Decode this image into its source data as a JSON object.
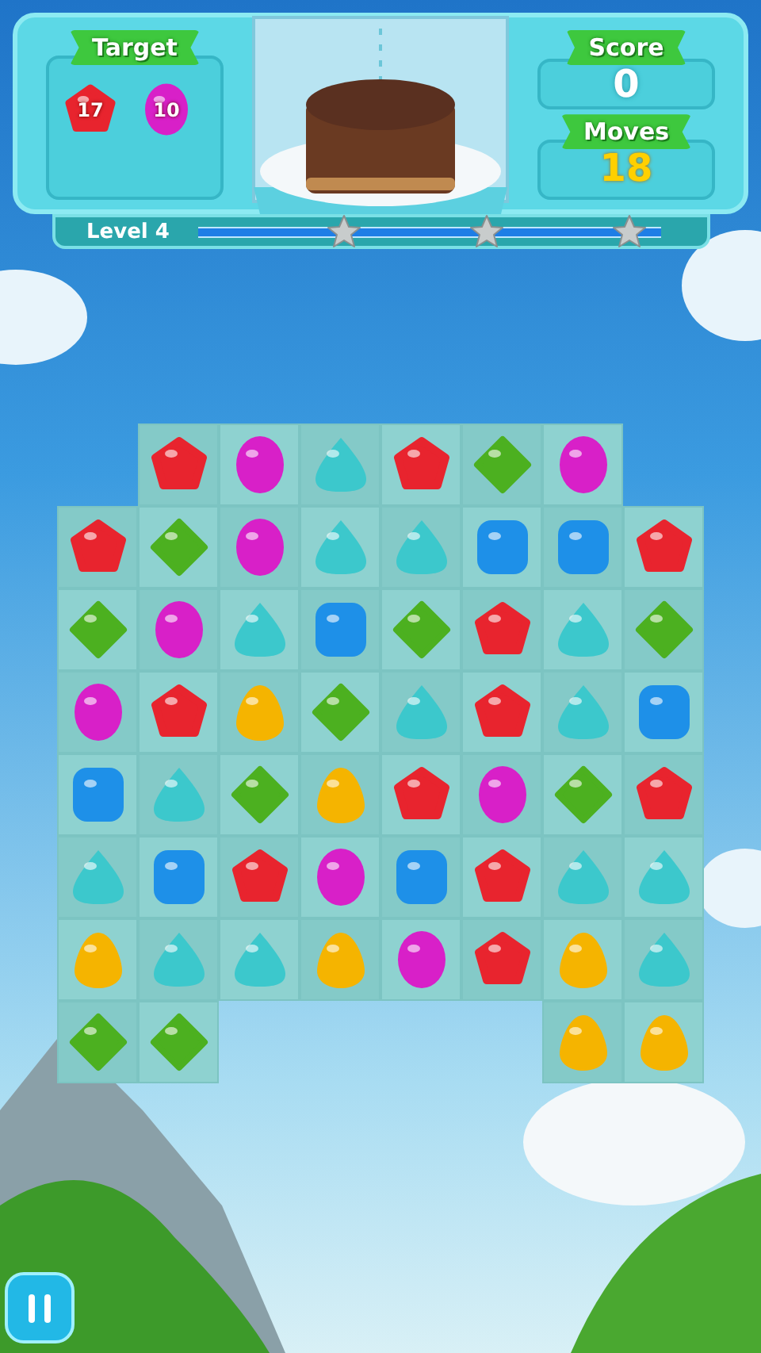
{
  "hud": {
    "target": {
      "label": "Target",
      "items": [
        {
          "kind": "pentagon",
          "count": "17"
        },
        {
          "kind": "oval",
          "count": "10"
        }
      ]
    },
    "score": {
      "label": "Score",
      "value": "0"
    },
    "moves": {
      "label": "Moves",
      "value": "18"
    }
  },
  "level_bar": {
    "label": "Level 4"
  },
  "board": {
    "rows": [
      [
        {
          "kind": "empty"
        },
        {
          "kind": "pentagon"
        },
        {
          "kind": "oval"
        },
        {
          "kind": "drop"
        },
        {
          "kind": "pentagon"
        },
        {
          "kind": "diamond"
        },
        {
          "kind": "oval"
        },
        {
          "kind": "empty"
        }
      ],
      [
        {
          "kind": "pentagon"
        },
        {
          "kind": "diamond"
        },
        {
          "kind": "oval"
        },
        {
          "kind": "drop"
        },
        {
          "kind": "drop"
        },
        {
          "kind": "square"
        },
        {
          "kind": "square"
        },
        {
          "kind": "pentagon"
        }
      ],
      [
        {
          "kind": "diamond"
        },
        {
          "kind": "oval"
        },
        {
          "kind": "drop"
        },
        {
          "kind": "square"
        },
        {
          "kind": "diamond"
        },
        {
          "kind": "pentagon"
        },
        {
          "kind": "drop"
        },
        {
          "kind": "diamond"
        }
      ],
      [
        {
          "kind": "oval"
        },
        {
          "kind": "pentagon"
        },
        {
          "kind": "egg"
        },
        {
          "kind": "diamond"
        },
        {
          "kind": "drop"
        },
        {
          "kind": "pentagon"
        },
        {
          "kind": "drop"
        },
        {
          "kind": "square"
        }
      ],
      [
        {
          "kind": "square"
        },
        {
          "kind": "drop"
        },
        {
          "kind": "diamond"
        },
        {
          "kind": "egg"
        },
        {
          "kind": "pentagon"
        },
        {
          "kind": "oval"
        },
        {
          "kind": "diamond"
        },
        {
          "kind": "pentagon"
        }
      ],
      [
        {
          "kind": "drop"
        },
        {
          "kind": "square"
        },
        {
          "kind": "pentagon"
        },
        {
          "kind": "oval"
        },
        {
          "kind": "square"
        },
        {
          "kind": "pentagon"
        },
        {
          "kind": "drop"
        },
        {
          "kind": "drop"
        }
      ],
      [
        {
          "kind": "egg"
        },
        {
          "kind": "drop"
        },
        {
          "kind": "drop"
        },
        {
          "kind": "egg"
        },
        {
          "kind": "oval"
        },
        {
          "kind": "pentagon"
        },
        {
          "kind": "egg"
        },
        {
          "kind": "drop"
        }
      ],
      [
        {
          "kind": "diamond"
        },
        {
          "kind": "diamond"
        },
        {
          "kind": "empty"
        },
        {
          "kind": "empty"
        },
        {
          "kind": "empty"
        },
        {
          "kind": "empty"
        },
        {
          "kind": "egg"
        },
        {
          "kind": "egg"
        }
      ]
    ]
  }
}
